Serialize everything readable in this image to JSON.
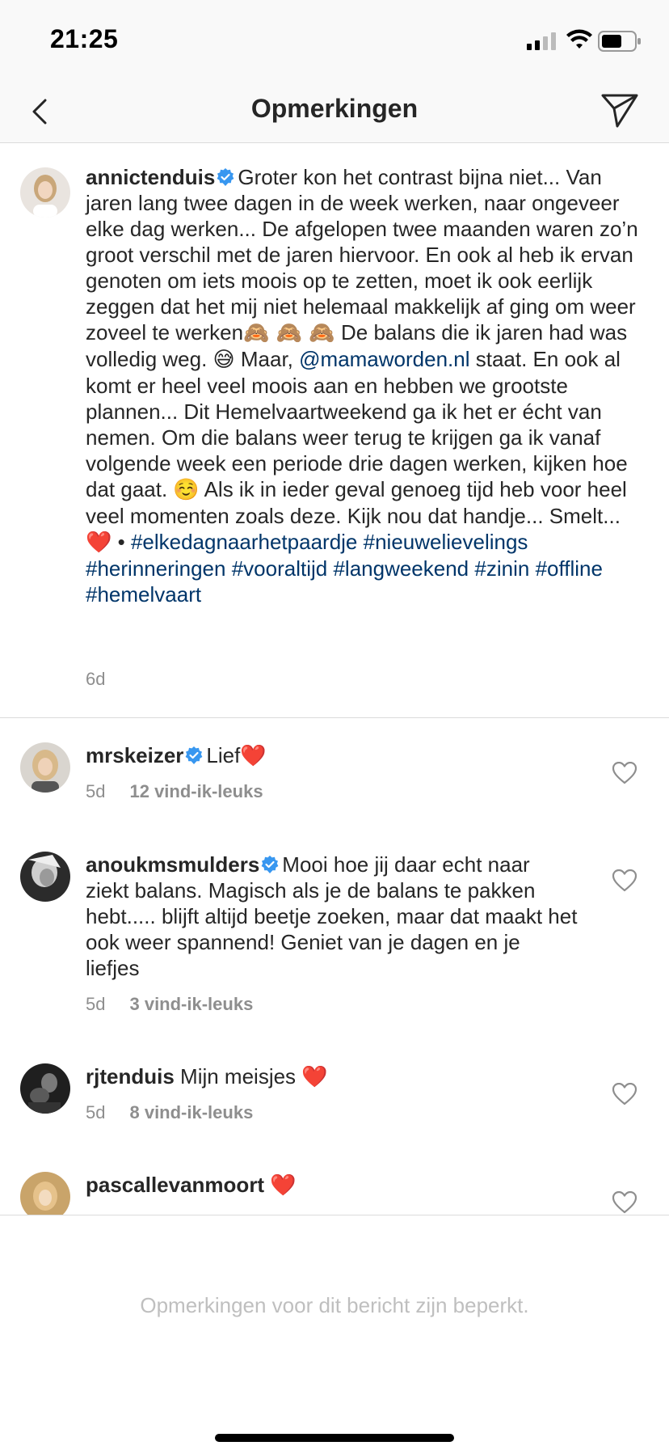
{
  "status_bar": {
    "time": "21:25"
  },
  "nav": {
    "title": "Opmerkingen",
    "back_icon": "chevron-left-icon",
    "send_icon": "paper-plane-icon"
  },
  "caption": {
    "username": "annictenduis",
    "verified": true,
    "text_1": "Groter kon het contrast bijna niet... Van jaren lang twee dagen in de week werken, naar ongeveer elke dag werken... De afgelopen twee maanden waren zo’n groot verschil met de jaren hiervoor. En ook al heb ik ervan genoten om iets moois op te zetten, moet ik ook eerlijk zeggen dat het mij niet helemaal makkelijk af ging om weer zoveel te werken",
    "emoji_1": "🙈 🙈 🙈",
    "text_2": " De balans die ik jaren had was volledig weg. ",
    "emoji_2": "😅",
    "text_3": " Maar, ",
    "mention": "@mamaworden.nl",
    "text_4": " staat. En ook al komt er heel veel moois aan en hebben we grootste plannen... Dit Hemelvaartweekend ga ik het er écht van nemen. Om die balans weer terug te krijgen ga ik vanaf volgende week een periode drie dagen werken, kijken hoe dat gaat. ",
    "emoji_3": "☺️",
    "text_5": " Als ik in ieder geval genoeg tijd heb voor heel veel momenten zoals deze. Kijk nou dat handje... Smelt... ",
    "emoji_4": "❤️",
    "text_6": " • ",
    "hashtags": [
      "#elkedagnaarhetpaardje",
      "#nieuwelievelings",
      "#herinneringen",
      "#vooraltijd",
      "#langweekend",
      "#zinin",
      "#offline",
      "#hemelvaart"
    ],
    "age": "6d"
  },
  "comments": [
    {
      "username": "mrskeizer",
      "verified": true,
      "text": "Lief",
      "emoji": "❤️",
      "age": "5d",
      "likes": "12 vind-ik-leuks"
    },
    {
      "username": "anoukmsmulders",
      "verified": true,
      "text": "Mooi hoe jij daar echt naar ziekt balans. Magisch als je de balans te pakken hebt..... blijft altijd beetje zoeken, maar dat maakt het ook weer spannend! Geniet van je dagen en je liefjes",
      "emoji": "",
      "age": "5d",
      "likes": "3 vind-ik-leuks"
    },
    {
      "username": "rjtenduis",
      "verified": false,
      "text": "Mijn meisjes ",
      "emoji": "❤️",
      "age": "5d",
      "likes": "8 vind-ik-leuks"
    },
    {
      "username": "pascallevanmoort",
      "verified": false,
      "text": " ",
      "emoji": "❤️",
      "age": "",
      "likes": ""
    }
  ],
  "footer": {
    "restricted": "Opmerkingen voor dit bericht zijn beperkt."
  },
  "colors": {
    "link": "#003569",
    "verified": "#3897f0",
    "muted": "#8e8e8e"
  }
}
